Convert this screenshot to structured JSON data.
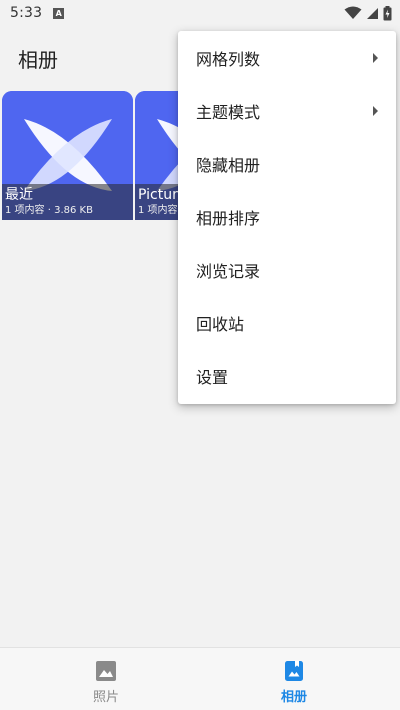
{
  "status_bar": {
    "time": "5:33",
    "notification_glyph": "A",
    "icons": [
      "wifi-icon",
      "signal-icon",
      "battery-charging-icon"
    ]
  },
  "header": {
    "title": "相册"
  },
  "albums": [
    {
      "name": "最近",
      "meta": "1 项内容 · 3.86 KB"
    },
    {
      "name": "Pictures",
      "meta": "1 项内容 · 3.86 KB"
    }
  ],
  "menu": {
    "items": [
      {
        "label": "网格列数",
        "has_submenu": true
      },
      {
        "label": "主题模式",
        "has_submenu": true
      },
      {
        "label": "隐藏相册",
        "has_submenu": false
      },
      {
        "label": "相册排序",
        "has_submenu": false
      },
      {
        "label": "浏览记录",
        "has_submenu": false
      },
      {
        "label": "回收站",
        "has_submenu": false
      },
      {
        "label": "设置",
        "has_submenu": false
      }
    ]
  },
  "bottom_nav": {
    "items": [
      {
        "label": "照片",
        "icon": "image-icon",
        "active": false
      },
      {
        "label": "相册",
        "icon": "album-icon",
        "active": true
      }
    ]
  },
  "colors": {
    "accent": "#1e88e5",
    "thumbnail": "#4f66f0",
    "background": "#f2f2f2"
  }
}
